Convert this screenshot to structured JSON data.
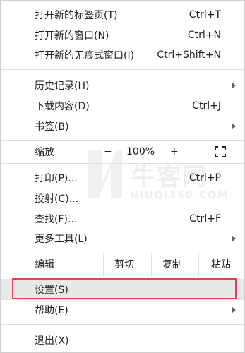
{
  "menu": {
    "group1": [
      {
        "label": "打开新的标签页(T)",
        "shortcut": "Ctrl+T"
      },
      {
        "label": "打开新的窗口(N)",
        "shortcut": "Ctrl+N"
      },
      {
        "label": "打开新的无痕式窗口(I)",
        "shortcut": "Ctrl+Shift+N"
      }
    ],
    "group2": [
      {
        "label": "历史记录(H)",
        "shortcut": ""
      },
      {
        "label": "下载内容(D)",
        "shortcut": "Ctrl+J"
      },
      {
        "label": "书签(B)",
        "shortcut": ""
      }
    ],
    "zoom": {
      "label": "缩放",
      "minus": "−",
      "value": "100%",
      "plus": "+"
    },
    "group3": [
      {
        "label": "打印(P)...",
        "shortcut": "Ctrl+P"
      },
      {
        "label": "投射(C)...",
        "shortcut": ""
      },
      {
        "label": "查找(F)...",
        "shortcut": "Ctrl+F"
      },
      {
        "label": "更多工具(L)",
        "shortcut": ""
      }
    ],
    "edit": {
      "label": "编辑",
      "cut": "剪切",
      "copy": "复制",
      "paste": "粘贴"
    },
    "group4": [
      {
        "label": "设置(S)"
      },
      {
        "label": "帮助(E)"
      }
    ],
    "exit": {
      "label": "退出(X)"
    }
  },
  "watermark": {
    "brand": "牛客网",
    "domain": "NIUQI360.COM"
  },
  "colors": {
    "highlight": "#e8e8e8",
    "annotation": "#e0454a"
  }
}
